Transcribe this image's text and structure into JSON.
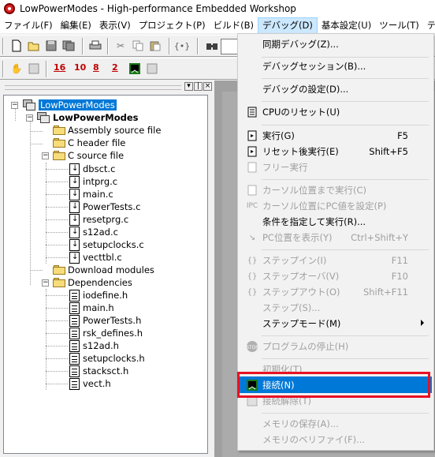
{
  "window": {
    "title": "LowPowerModes - High-performance Embedded Workshop"
  },
  "menubar": [
    {
      "label": "ファイル(F)"
    },
    {
      "label": "編集(E)"
    },
    {
      "label": "表示(V)"
    },
    {
      "label": "プロジェクト(P)"
    },
    {
      "label": "ビルド(B)"
    },
    {
      "label": "デバッグ(D)"
    },
    {
      "label": "基本設定(U)"
    },
    {
      "label": "ツール(T)"
    },
    {
      "label": "テスト(S)"
    }
  ],
  "toolbar2_numbers": [
    "16",
    "10",
    "8",
    "2"
  ],
  "workspace": {
    "workspace_name": "LowPowerModes",
    "project_name": "LowPowerModes",
    "folders": {
      "assembly": "Assembly source file",
      "cheader": "C header file",
      "csource": "C source file",
      "download": "Download modules",
      "deps": "Dependencies"
    },
    "c_files": [
      "dbsct.c",
      "intprg.c",
      "main.c",
      "PowerTests.c",
      "resetprg.c",
      "s12ad.c",
      "setupclocks.c",
      "vecttbl.c"
    ],
    "dep_files": [
      "iodefine.h",
      "main.h",
      "PowerTests.h",
      "rsk_defines.h",
      "s12ad.h",
      "setupclocks.h",
      "stacksct.h",
      "vect.h"
    ]
  },
  "debug_menu": {
    "items": [
      {
        "label": "同期デバッグ(Z)...",
        "shortcut": ""
      },
      {
        "label": "デバッグセッション(B)...",
        "shortcut": ""
      },
      {
        "label": "デバッグの設定(D)...",
        "shortcut": ""
      },
      {
        "label": "CPUのリセット(U)",
        "shortcut": ""
      },
      {
        "label": "実行(G)",
        "shortcut": "F5"
      },
      {
        "label": "リセット後実行(E)",
        "shortcut": "Shift+F5"
      },
      {
        "label": "フリー実行",
        "shortcut": ""
      },
      {
        "label": "カーソル位置まで実行(C)",
        "shortcut": ""
      },
      {
        "label": "カーソル位置にPC値を設定(P)",
        "shortcut": ""
      },
      {
        "label": "条件を指定して実行(R)...",
        "shortcut": ""
      },
      {
        "label": "PC位置を表示(Y)",
        "shortcut": "Ctrl+Shift+Y"
      },
      {
        "label": "ステップイン(I)",
        "shortcut": "F11"
      },
      {
        "label": "ステップオーバ(V)",
        "shortcut": "F10"
      },
      {
        "label": "ステップアウト(O)",
        "shortcut": "Shift+F11"
      },
      {
        "label": "ステップ(S)...",
        "shortcut": ""
      },
      {
        "label": "ステップモード(M)",
        "shortcut": ""
      },
      {
        "label": "プログラムの停止(H)",
        "shortcut": ""
      },
      {
        "label": "初期化(T)",
        "shortcut": ""
      },
      {
        "label": "接続(N)",
        "shortcut": ""
      },
      {
        "label": "接続解除(T)",
        "shortcut": ""
      },
      {
        "label": "メモリの保存(A)...",
        "shortcut": ""
      },
      {
        "label": "メモリのベリファイ(F)...",
        "shortcut": ""
      }
    ]
  },
  "colors": {
    "highlight": "#0078d7",
    "annotation_box": "#e81123",
    "menu_active": "#cce8ff"
  }
}
